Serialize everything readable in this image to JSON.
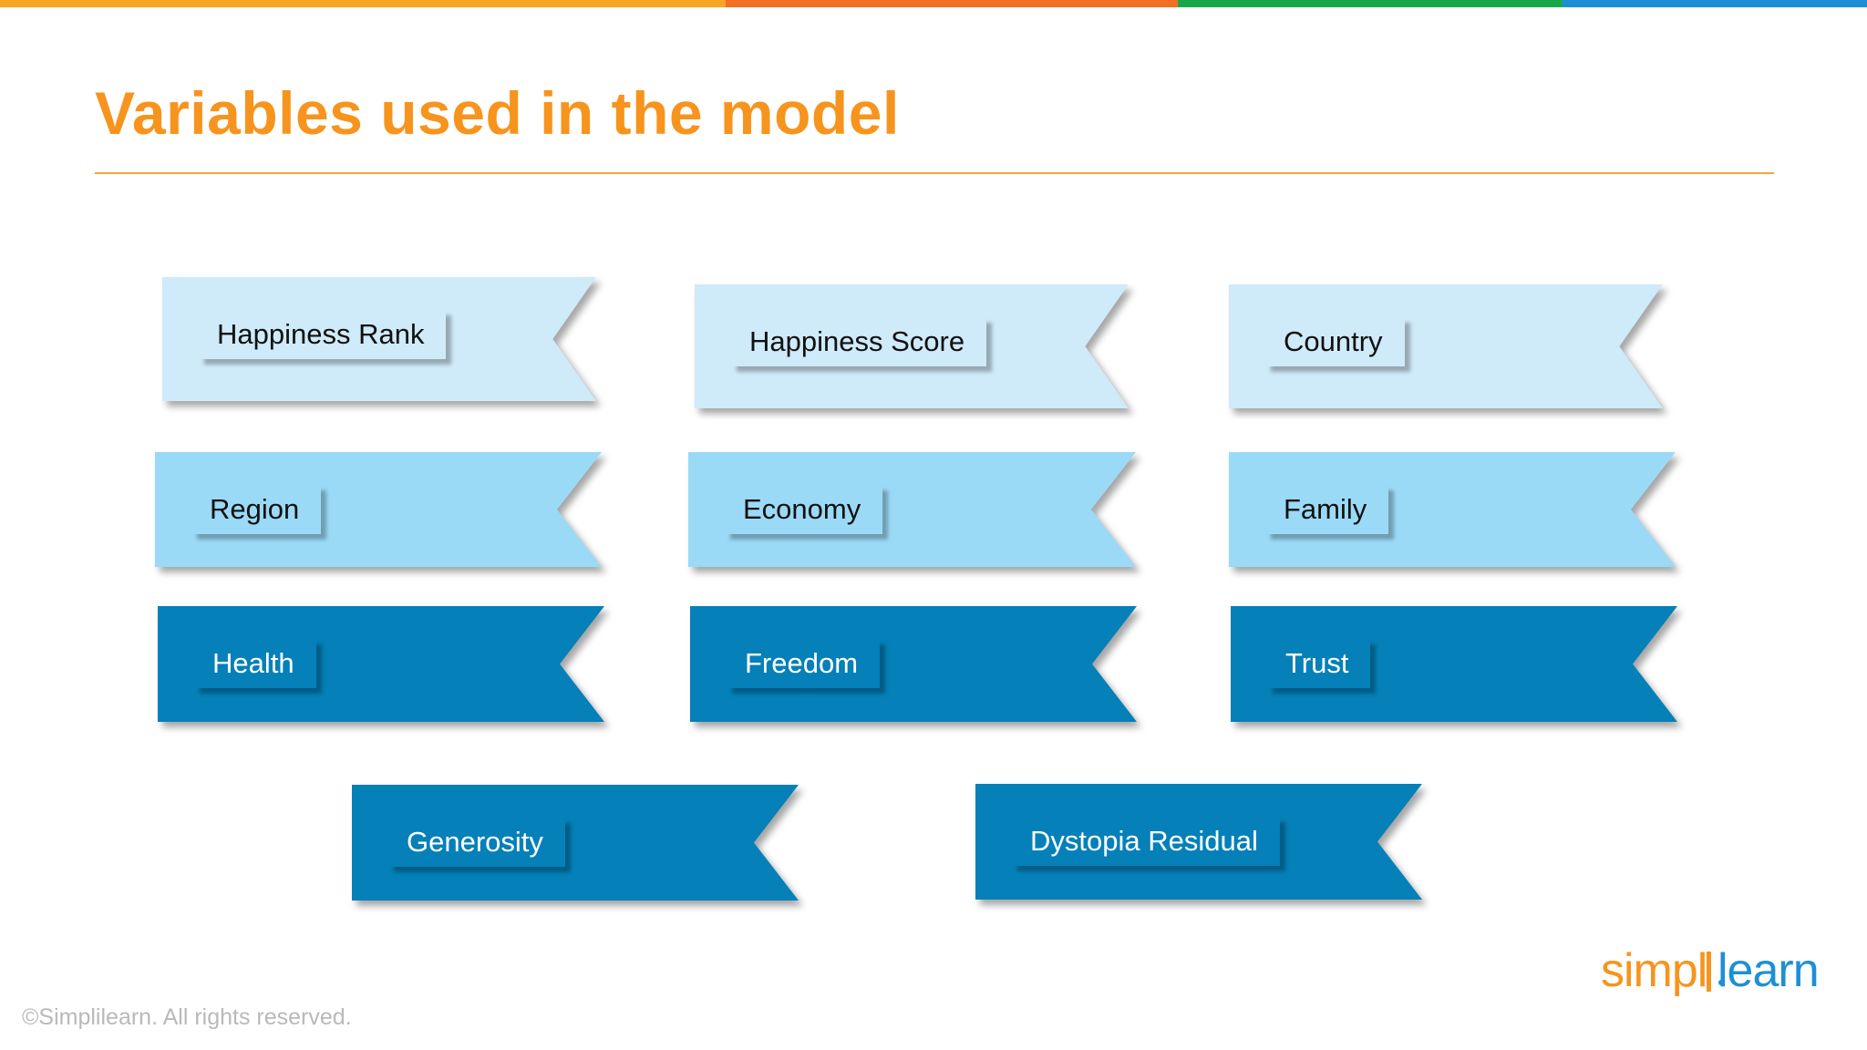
{
  "colors": {
    "title": "#f7941d",
    "rule": "#f4a63a",
    "topbar": [
      "#f6a623",
      "#f26f24",
      "#1ba84a",
      "#1e8fd6"
    ],
    "light": "#cfeaf9",
    "medium": "#9bdaf6",
    "dark": "#0580b8",
    "dark_text": "#ffffff",
    "light_text": "#111111"
  },
  "title": "Variables used in the model",
  "variables": [
    {
      "label": "Happiness Rank",
      "shade": "light"
    },
    {
      "label": "Happiness Score",
      "shade": "light"
    },
    {
      "label": "Country",
      "shade": "light"
    },
    {
      "label": "Region",
      "shade": "medium"
    },
    {
      "label": "Economy",
      "shade": "medium"
    },
    {
      "label": "Family",
      "shade": "medium"
    },
    {
      "label": "Health",
      "shade": "dark"
    },
    {
      "label": "Freedom",
      "shade": "dark"
    },
    {
      "label": "Trust",
      "shade": "dark"
    },
    {
      "label": "Generosity",
      "shade": "dark"
    },
    {
      "label": "Dystopia Residual",
      "shade": "dark"
    }
  ],
  "footer": "©Simplilearn. All rights reserved.",
  "logo": {
    "part1": "simpl",
    "part2": "learn"
  }
}
